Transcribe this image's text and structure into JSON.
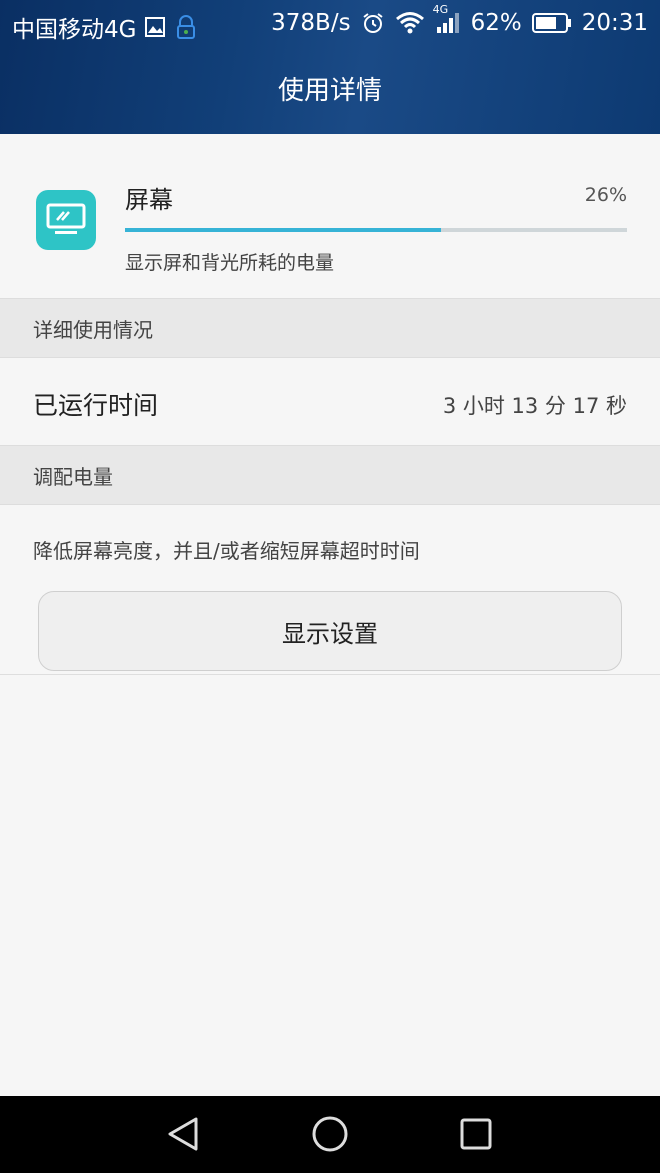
{
  "status_bar": {
    "carrier": "中国移动4G",
    "speed": "378B/s",
    "network": "4G",
    "battery_pct": "62%",
    "time": "20:31"
  },
  "header": {
    "title": "使用详情"
  },
  "screen_item": {
    "title": "屏幕",
    "percent": "26%",
    "progress_fraction": 0.63,
    "description": "显示屏和背光所耗的电量",
    "icon": "monitor-icon",
    "icon_color": "#2ec4c6",
    "progress_color": "#36b3d6"
  },
  "details": {
    "section_title": "详细使用情况",
    "runtime_label": "已运行时间",
    "runtime_value": "3 小时 13 分 17 秒"
  },
  "adjust": {
    "section_title": "调配电量",
    "tip": "降低屏幕亮度，并且/或者缩短屏幕超时时间",
    "button_label": "显示设置"
  },
  "navbar": {
    "icons": [
      "back-icon",
      "home-icon",
      "recents-icon"
    ]
  }
}
